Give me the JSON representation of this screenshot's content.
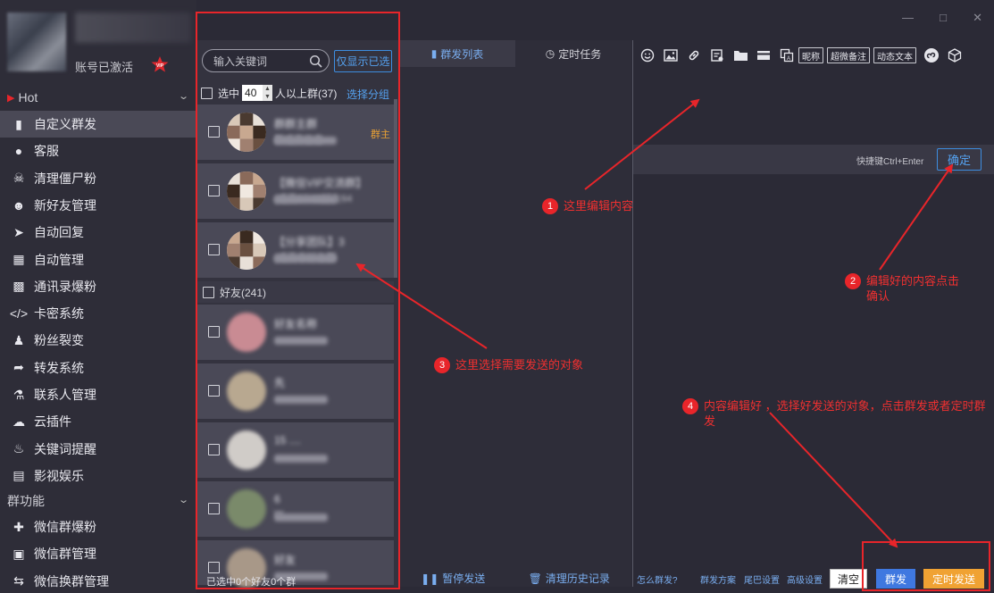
{
  "account": {
    "status": "账号已激活",
    "vip": "VIP"
  },
  "sidebar": {
    "hot_label": "Hot",
    "items": [
      {
        "label": "自定义群发",
        "icon": "chat-icon"
      },
      {
        "label": "客服",
        "icon": "user-icon"
      },
      {
        "label": "清理僵尸粉",
        "icon": "skull-icon"
      },
      {
        "label": "新好友管理",
        "icon": "person-icon"
      },
      {
        "label": "自动回复",
        "icon": "send-icon"
      },
      {
        "label": "自动管理",
        "icon": "contact-card-icon"
      },
      {
        "label": "通讯录爆粉",
        "icon": "address-book-icon"
      },
      {
        "label": "卡密系统",
        "icon": "code-icon"
      },
      {
        "label": "粉丝裂变",
        "icon": "group-icon"
      },
      {
        "label": "转发系统",
        "icon": "forward-icon"
      },
      {
        "label": "联系人管理",
        "icon": "org-chart-icon"
      },
      {
        "label": "云插件",
        "icon": "cloud-icon"
      },
      {
        "label": "关键词提醒",
        "icon": "bell-icon"
      },
      {
        "label": "影视娱乐",
        "icon": "film-icon"
      }
    ],
    "group_label": "群功能",
    "group_items": [
      {
        "label": "微信群爆粉",
        "icon": "add-user-icon"
      },
      {
        "label": "微信群管理",
        "icon": "briefcase-icon"
      },
      {
        "label": "微信换群管理",
        "icon": "swap-icon"
      }
    ]
  },
  "contacts": {
    "search_placeholder": "输入关键词",
    "show_selected": "仅显示已选",
    "filter_prefix": "选中",
    "filter_value": "40",
    "filter_suffix": "人以上群(37)",
    "select_group": "选择分组",
    "groups": [
      {
        "name": "群群主群",
        "sub": "群成员信息",
        "role": "群主"
      },
      {
        "name": "【微信VIP交流群】",
        "sub": "(成员67/48好友64",
        "role": ""
      },
      {
        "name": "【分享团队】3",
        "sub": "(成员非好友群",
        "role": ""
      }
    ],
    "friends_header": "好友(241)",
    "friends": [
      {
        "name": "好友名称",
        "sub": ""
      },
      {
        "name": "先",
        "sub": ""
      },
      {
        "name": "15 ....",
        "sub": ""
      },
      {
        "name": "6",
        "sub": "W"
      },
      {
        "name": "好友",
        "sub": ""
      }
    ],
    "status": "已选中0个好友0个群"
  },
  "middle": {
    "tab_broadcast": "群发列表",
    "tab_scheduled": "定时任务",
    "pause": "暂停发送",
    "clear_history": "清理历史记录"
  },
  "editor": {
    "toolbar_buttons": [
      "昵称",
      "超微备注",
      "动态文本"
    ],
    "shortcut_hint": "快捷键Ctrl+Enter",
    "confirm": "确定",
    "footer_links": [
      "怎么群发?",
      "群发方案",
      "尾巴设置",
      "高级设置"
    ],
    "clear": "清空",
    "send": "群发",
    "timed_send": "定时发送"
  },
  "annotations": [
    {
      "num": "1",
      "text": "这里编辑内容"
    },
    {
      "num": "2",
      "text": "编辑好的内容点击确认"
    },
    {
      "num": "3",
      "text": "这里选择需要发送的对象"
    },
    {
      "num": "4",
      "text": "内容编辑好 ，选择好发送的对象，点击群发或者定时群发"
    }
  ],
  "colors": {
    "accent_blue": "#3d8de0",
    "timed_orange": "#f0a233",
    "annotation_red": "#e8252a",
    "bg_dark": "#2b2a36"
  }
}
